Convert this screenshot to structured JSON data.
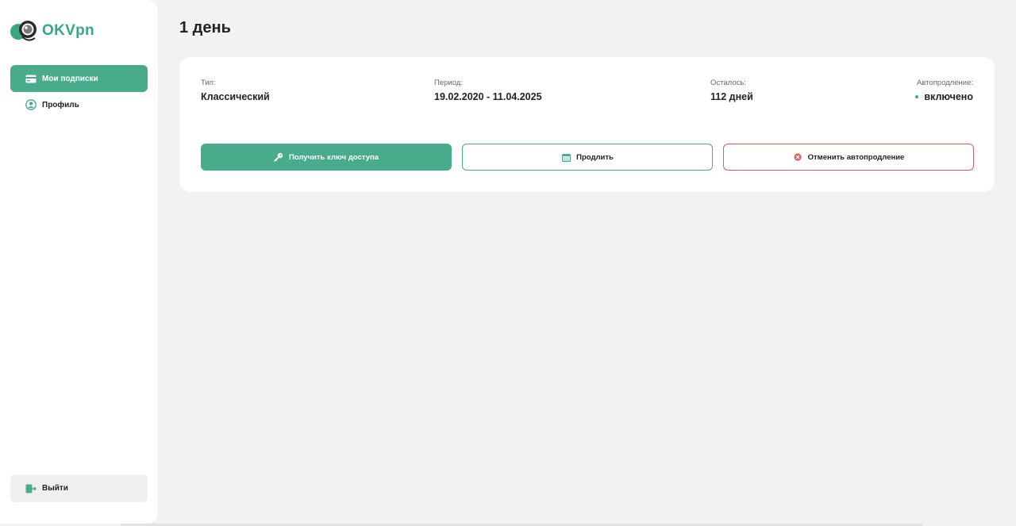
{
  "brand": {
    "name": "OKVpn",
    "accent": "#48ab8c",
    "danger": "#e45a5a"
  },
  "sidebar": {
    "items": [
      {
        "label": "Мои подписки",
        "icon": "card-icon",
        "active": true
      },
      {
        "label": "Профиль",
        "icon": "user-circle-icon",
        "active": false
      }
    ],
    "logout": {
      "label": "Выйти",
      "icon": "logout-icon"
    }
  },
  "main": {
    "title": "1 день",
    "subscription": {
      "type_label": "Тип:",
      "type_value": "Классический",
      "period_label": "Период:",
      "period_value": "19.02.2020 - 11.04.2025",
      "left_label": "Осталось:",
      "left_value": "112 дней",
      "auto_label": "Автопродление:",
      "auto_value": "включено"
    },
    "actions": {
      "get_key": {
        "label": "Получить ключ доступа",
        "icon": "key-icon"
      },
      "extend": {
        "label": "Продлить",
        "icon": "calendar-icon"
      },
      "cancel_auto": {
        "label": "Отменить автопродление",
        "icon": "x-circle-icon"
      }
    }
  }
}
